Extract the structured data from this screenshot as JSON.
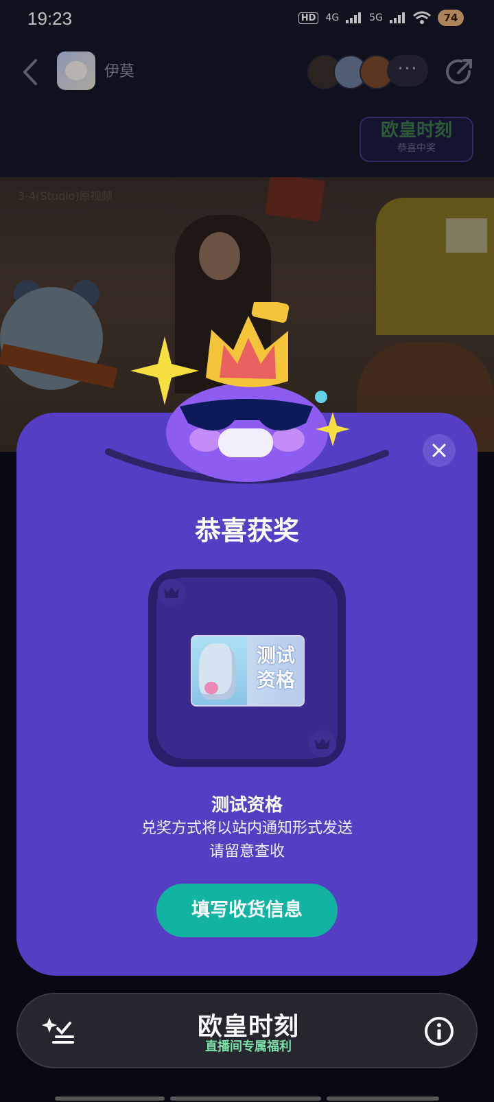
{
  "status_bar": {
    "time": "19:23",
    "hd_label": "HD",
    "net1": "4G",
    "net2": "5G",
    "battery": "74"
  },
  "top_nav": {
    "room_name": "伊莫",
    "more_label": "···",
    "event_badge_title": "欧皇时刻",
    "event_badge_subtitle": "恭喜中奖"
  },
  "video": {
    "watermark": "3-4(Studio)原视频"
  },
  "modal": {
    "title": "恭喜获奖",
    "prize_card_text_line1": "测试",
    "prize_card_text_line2": "资格",
    "prize_name": "测试资格",
    "notice_line1": "兑奖方式将以站内通知形式发送",
    "notice_line2": "请留意查收",
    "fill_button_label": "填写收货信息"
  },
  "bottom_bar": {
    "brand_title": "欧皇时刻",
    "brand_subtitle": "直播间专属福利"
  },
  "colors": {
    "modal_bg": "#553ec4",
    "prize_frame": "#291e6a",
    "button_accent": "#13b3a2",
    "bottom_bar_bg": "#26262e"
  },
  "icons": [
    "back-icon",
    "share-icon",
    "close-icon",
    "crown-icon",
    "task-list-icon",
    "info-icon",
    "wifi-icon",
    "signal-icon"
  ]
}
